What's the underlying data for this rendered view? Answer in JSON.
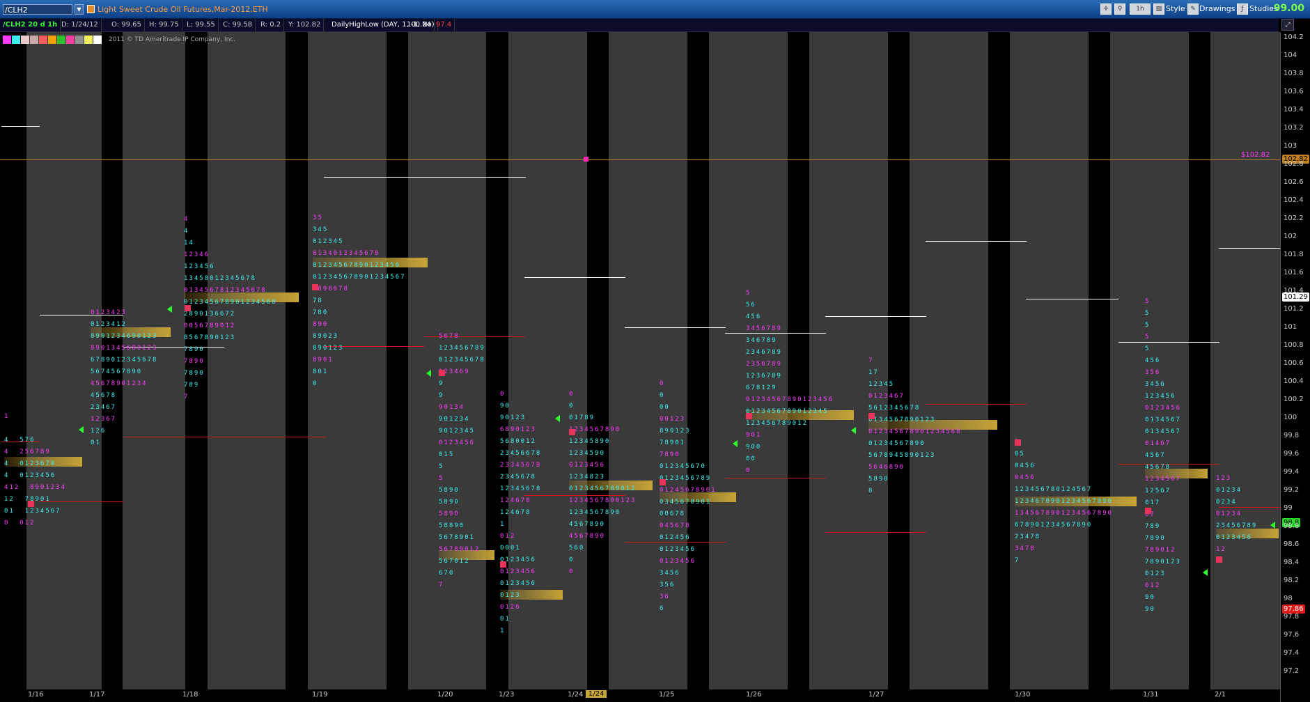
{
  "toolbar": {
    "symbol": "/CLH2",
    "description": "Light Sweet Crude Oil Futures,Mar-2012,ETH",
    "timeframe": "1h",
    "style_label": "Style",
    "drawings_label": "Drawings",
    "studies_label": "Studies",
    "last_price": "99.00"
  },
  "info": {
    "name": "/CLH2 20 d 1h",
    "date": "D: 1/24/12",
    "open": "O: 99.65",
    "high": "H: 99.75",
    "low": "L: 99.55",
    "close": "C: 99.58",
    "range": "R: 0.2",
    "y": "Y: 102.82",
    "study": "DailyHighLow (DAY, 1, -1, No)",
    "study_high": "100.24",
    "study_low": "97.4"
  },
  "copyright": "2011 © TD Ameritrade IP Company, Inc.",
  "colors": {
    "magenta": "#ff3cff",
    "cyan": "#3cf0f0",
    "bg_bar": "#3a3a3a",
    "poc": "#c7a437"
  },
  "y_axis": {
    "ticks": [
      "104.2",
      "104",
      "103.8",
      "103.6",
      "103.4",
      "103.2",
      "103",
      "102.8",
      "102.6",
      "102.4",
      "102.2",
      "102",
      "101.8",
      "101.6",
      "101.4",
      "101.2",
      "101",
      "100.8",
      "100.6",
      "100.4",
      "100.2",
      "100",
      "99.8",
      "99.6",
      "99.4",
      "99.2",
      "99",
      "98.8",
      "98.6",
      "98.4",
      "98.2",
      "98",
      "97.8",
      "97.6",
      "97.4",
      "97.2"
    ],
    "tag_current": "102.82",
    "tag_high": "101.29",
    "tag_last": "98.8",
    "tag_low": "97.86"
  },
  "cursor_label": "$102.82",
  "x_axis": {
    "dates": [
      "1/16",
      "1/17",
      "1/18",
      "1/19",
      "1/20",
      "1/23",
      "1/24",
      "1/25",
      "1/26",
      "1/27",
      "1/30",
      "1/31",
      "2/1"
    ],
    "cursor_date": "1/24"
  },
  "tpo": [
    {
      "d": "1/16",
      "lines": [
        "1",
        "",
        "4  576",
        "4  256789",
        "4  0123670",
        "4  0123456",
        "412  8901234",
        "12  78901",
        "01  1234567",
        "0  012"
      ]
    },
    {
      "d": "1/17",
      "lines": [
        "0123423",
        "0123412",
        "8901234690123",
        "8901345680123",
        "6789012345678",
        "5674567890",
        "45678901234",
        "45678",
        "23467",
        "12367",
        "126",
        "01"
      ]
    },
    {
      "d": "1/18",
      "lines": [
        "4",
        "4",
        "14",
        "12346",
        "123456",
        "13458012345678",
        "0134567812345678",
        "012345678901234568",
        "2890136672",
        "0056789012",
        "8567890123",
        "7890",
        "7890",
        "7890",
        "789",
        "7"
      ]
    },
    {
      "d": "1/19",
      "lines": [
        "35",
        "345",
        "012345",
        "0134012345678",
        "01234567890123456",
        "012345678901234567",
        "2898678",
        "78",
        "780",
        "890",
        "89023",
        "890123",
        "8901",
        "801",
        "0"
      ]
    },
    {
      "d": "1/20",
      "lines": [
        "5678",
        "123456789",
        "012345678",
        "123469",
        "9",
        "9",
        "90134",
        "901234",
        "9012345",
        "0123456",
        "015",
        "5",
        "5",
        "5890",
        "5890",
        "5890",
        "58890",
        "5678901",
        "56789012",
        "567012",
        "670",
        "7"
      ]
    },
    {
      "d": "1/23",
      "lines": [
        "0",
        "90",
        "90123",
        "6890123",
        "5680012",
        "23456678",
        "23345678",
        "2345678",
        "12345678",
        "124678",
        "124678",
        "1",
        "012",
        "0001",
        "0123456",
        "0123456",
        "0123456",
        "0123",
        "0126",
        "01",
        "1"
      ]
    },
    {
      "d": "1/24",
      "lines": [
        "0",
        "0",
        "01789",
        "1234567890",
        "12345890",
        "1234590",
        "0123456",
        "1234823",
        "0123456789012",
        "1234567890123",
        "1234567890",
        "4567890",
        "4567890",
        "560",
        "0",
        "0"
      ]
    },
    {
      "d": "1/25",
      "lines": [
        "0",
        "0",
        "00",
        "00123",
        "890123",
        "78901",
        "7890",
        "012345670",
        "0123456789",
        "01245678901",
        "0345678901",
        "00678",
        "045678",
        "012456",
        "0123456",
        "0123456",
        "3456",
        "356",
        "36",
        "6"
      ]
    },
    {
      "d": "1/26",
      "lines": [
        "5",
        "56",
        "456",
        "3456789",
        "346789",
        "2346789",
        "2356789",
        "1236789",
        "678129",
        "01234567890123456",
        "0123456789012345",
        "123456789012",
        "901",
        "900",
        "00",
        "0"
      ]
    },
    {
      "d": "1/27",
      "lines": [
        "7",
        "17",
        "12345",
        "0123467",
        "5612345678",
        "0134567890123",
        "012345678901234568",
        "01234567890",
        "5678945890123",
        "5646890",
        "5890",
        "8"
      ]
    },
    {
      "d": "1/30",
      "lines": [
        "7",
        "05",
        "0456",
        "0456",
        "123456780124567",
        "1234678901234567890",
        "1345678901234567890",
        "678901234567890",
        "23478",
        "3478",
        "7"
      ]
    },
    {
      "d": "1/31",
      "lines": [
        "5",
        "5",
        "5",
        "5",
        "5",
        "456",
        "356",
        "3456",
        "123456",
        "0123456",
        "0134567",
        "0134567",
        "01467",
        "4567",
        "45678",
        "1234567",
        "12567",
        "017",
        "07",
        "789",
        "7890",
        "789012",
        "7890123",
        "0123",
        "012",
        "90",
        "90"
      ]
    },
    {
      "d": "2/1",
      "lines": [
        "123",
        "01234",
        "0234",
        "01234",
        "23456789",
        "0123456",
        "12"
      ]
    }
  ]
}
